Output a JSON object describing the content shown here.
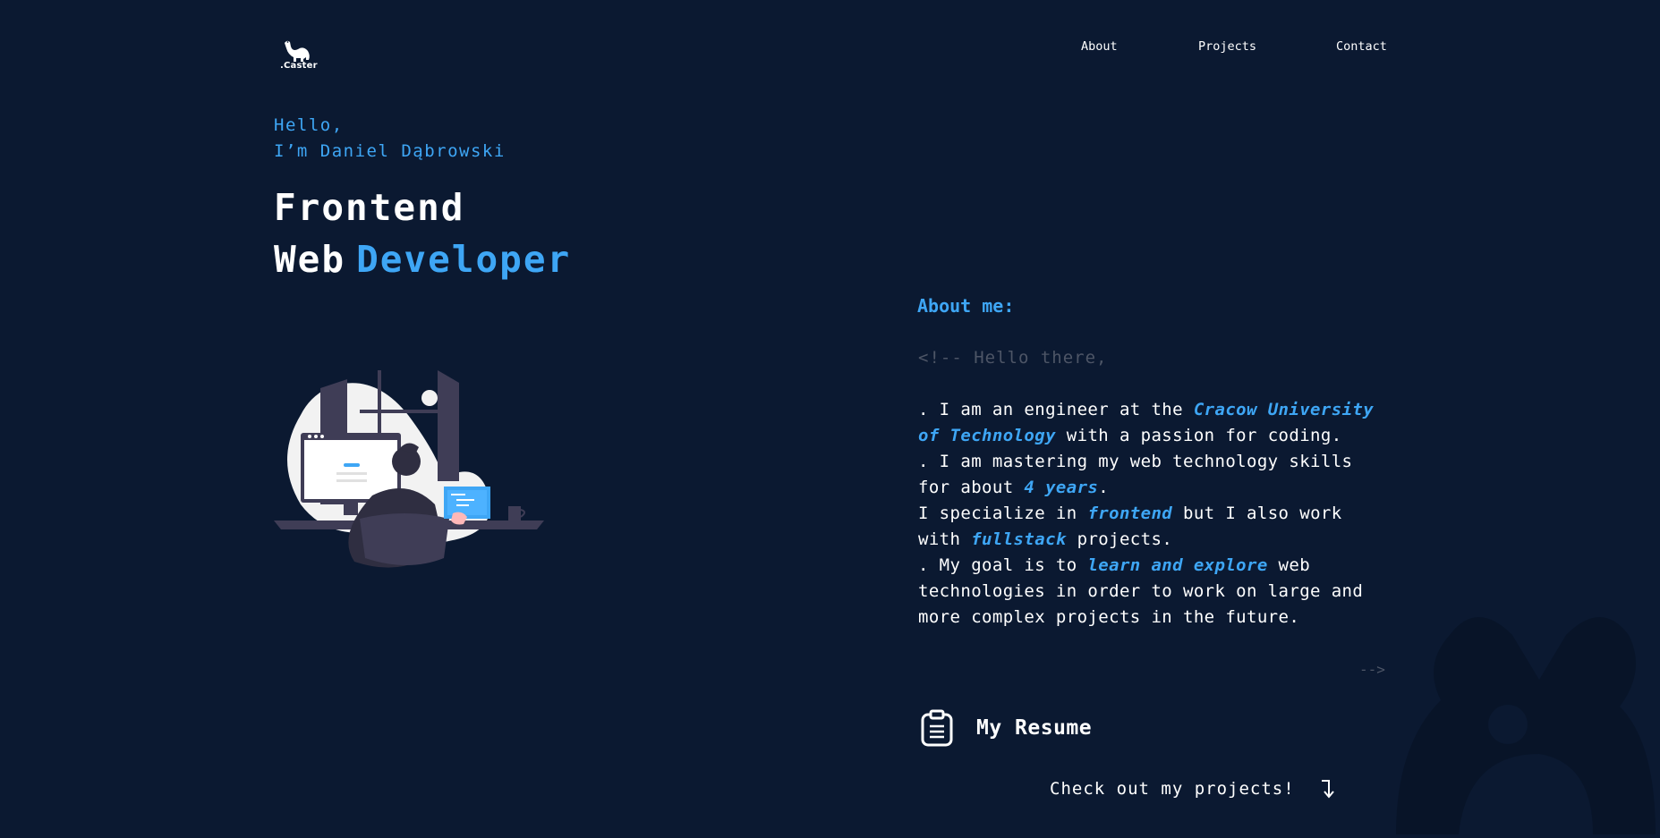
{
  "header": {
    "logo_text": ".Caster",
    "nav": [
      {
        "label": "About"
      },
      {
        "label": "Projects"
      },
      {
        "label": "Contact"
      }
    ]
  },
  "hero": {
    "greeting_line1": "Hello,",
    "greeting_line2": "I’m Daniel Dąbrowski",
    "title_line1": "Frontend",
    "title_line2_white": "Web",
    "title_line2_accent": "Developer"
  },
  "about": {
    "heading": "About me:",
    "comment_open": "<!-- Hello there,",
    "comment_close": "-->",
    "p1_a": ". I am an engineer at the ",
    "p1_hl": "Cracow University of Technology",
    "p1_b": " with a passion for coding.",
    "p2_a": ". I am mastering my web technology skills for about ",
    "p2_hl": "4 years",
    "p2_b": ".",
    "p3_a": "I specialize in ",
    "p3_hl1": "frontend",
    "p3_b": " but I also work with ",
    "p3_hl2": "fullstack",
    "p3_c": " projects.",
    "p4_a": ". My goal is to ",
    "p4_hl": "learn and explore",
    "p4_b": " web technologies in order to work on large and more complex projects in the future."
  },
  "resume": {
    "label": "My Resume",
    "icon": "clipboard-icon"
  },
  "cta": {
    "label": "Check out my projects!",
    "icon": "arrow-down-right-icon"
  },
  "colors": {
    "background": "#0b1931",
    "accent": "#3ea6f5",
    "comment": "#4d5566",
    "text": "#ffffff"
  }
}
